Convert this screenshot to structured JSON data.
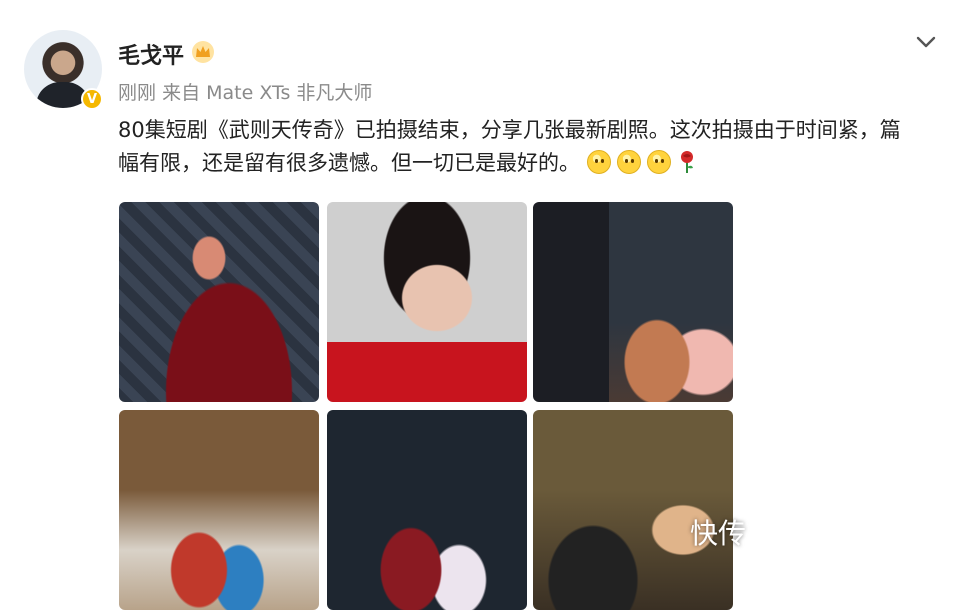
{
  "user": {
    "name": "毛戈平",
    "verified_badge": "V"
  },
  "meta": {
    "time": "刚刚",
    "source": "来自 Mate XTs 非凡大师"
  },
  "post": {
    "text": "80集短剧《武则天传奇》已拍摄结束，分享几张最新剧照。这次拍摄由于时间紧，篇幅有限，还是留有很多遗憾。但一切已是最好的。",
    "emojis": [
      "smile-emoji",
      "smile-emoji",
      "smile-emoji",
      "rose-emoji"
    ]
  },
  "photos": [
    "photo-1",
    "photo-2",
    "photo-3",
    "photo-4",
    "photo-5",
    "photo-6"
  ],
  "watermark": "快传",
  "colors": {
    "badge": "#f5b800",
    "meta_text": "#8a8a8a"
  }
}
